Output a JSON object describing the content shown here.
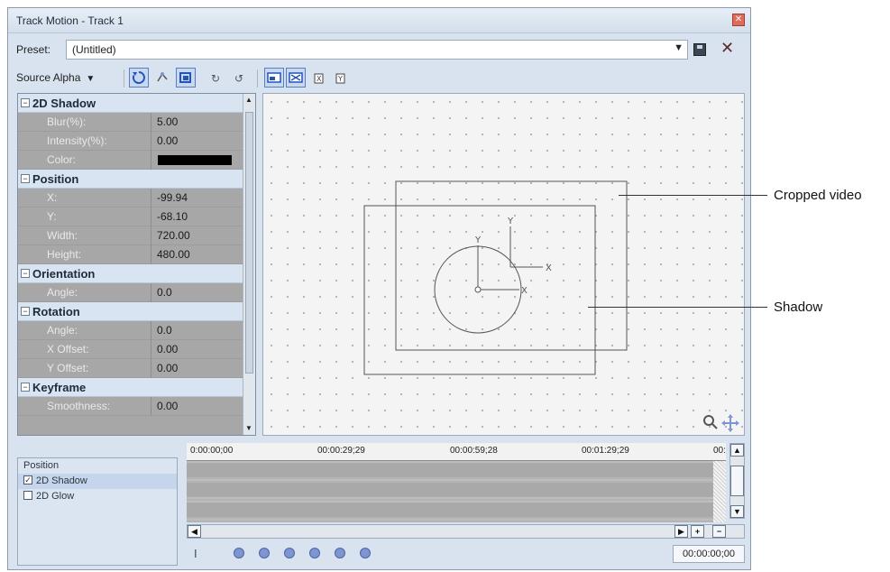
{
  "window": {
    "title": "Track Motion - Track 1",
    "close_glyph": "✕"
  },
  "preset": {
    "label": "Preset:",
    "value": "(Untitled)",
    "dropdown_glyph": "▼",
    "delete_glyph": "✕"
  },
  "toolbar": {
    "source_alpha": "Source Alpha",
    "dropdown_glyph": "▼"
  },
  "props": {
    "shadow": {
      "header": "2D Shadow",
      "blur_label": "Blur(%):",
      "blur": "5.00",
      "intensity_label": "Intensity(%):",
      "intensity": "0.00",
      "color_label": "Color:",
      "color": "#000000"
    },
    "position": {
      "header": "Position",
      "x_label": "X:",
      "x": "-99.94",
      "y_label": "Y:",
      "y": "-68.10",
      "width_label": "Width:",
      "width": "720.00",
      "height_label": "Height:",
      "height": "480.00"
    },
    "orientation": {
      "header": "Orientation",
      "angle_label": "Angle:",
      "angle": "0.0"
    },
    "rotation": {
      "header": "Rotation",
      "angle_label": "Angle:",
      "angle": "0.0",
      "xoff_label": "X Offset:",
      "xoff": "0.00",
      "yoff_label": "Y Offset:",
      "yoff": "0.00"
    },
    "keyframe": {
      "header": "Keyframe",
      "smooth_label": "Smoothness:",
      "smooth": "0.00"
    },
    "collapse_glyph": "−"
  },
  "canvas": {
    "axis_x": "X",
    "axis_y": "Y"
  },
  "timeline": {
    "tracks": [
      {
        "label": "Position",
        "checked": false,
        "has_checkbox": false
      },
      {
        "label": "2D Shadow",
        "checked": true,
        "has_checkbox": true
      },
      {
        "label": "2D Glow",
        "checked": false,
        "has_checkbox": true
      }
    ],
    "check_glyph": "✓",
    "ruler": [
      "0:00:00;00",
      "00:00:29;29",
      "00:00:59;28",
      "00:01:29;29",
      "00:"
    ],
    "time": "00:00:00;00"
  },
  "callouts": {
    "cropped": "Cropped video",
    "shadow": "Shadow"
  },
  "colors": {
    "accent": "#5a7fbf",
    "grid_bg": "#f4f4f4",
    "props_bg": "#a7a7a7",
    "keyframe_btn": "#7e95d2"
  }
}
